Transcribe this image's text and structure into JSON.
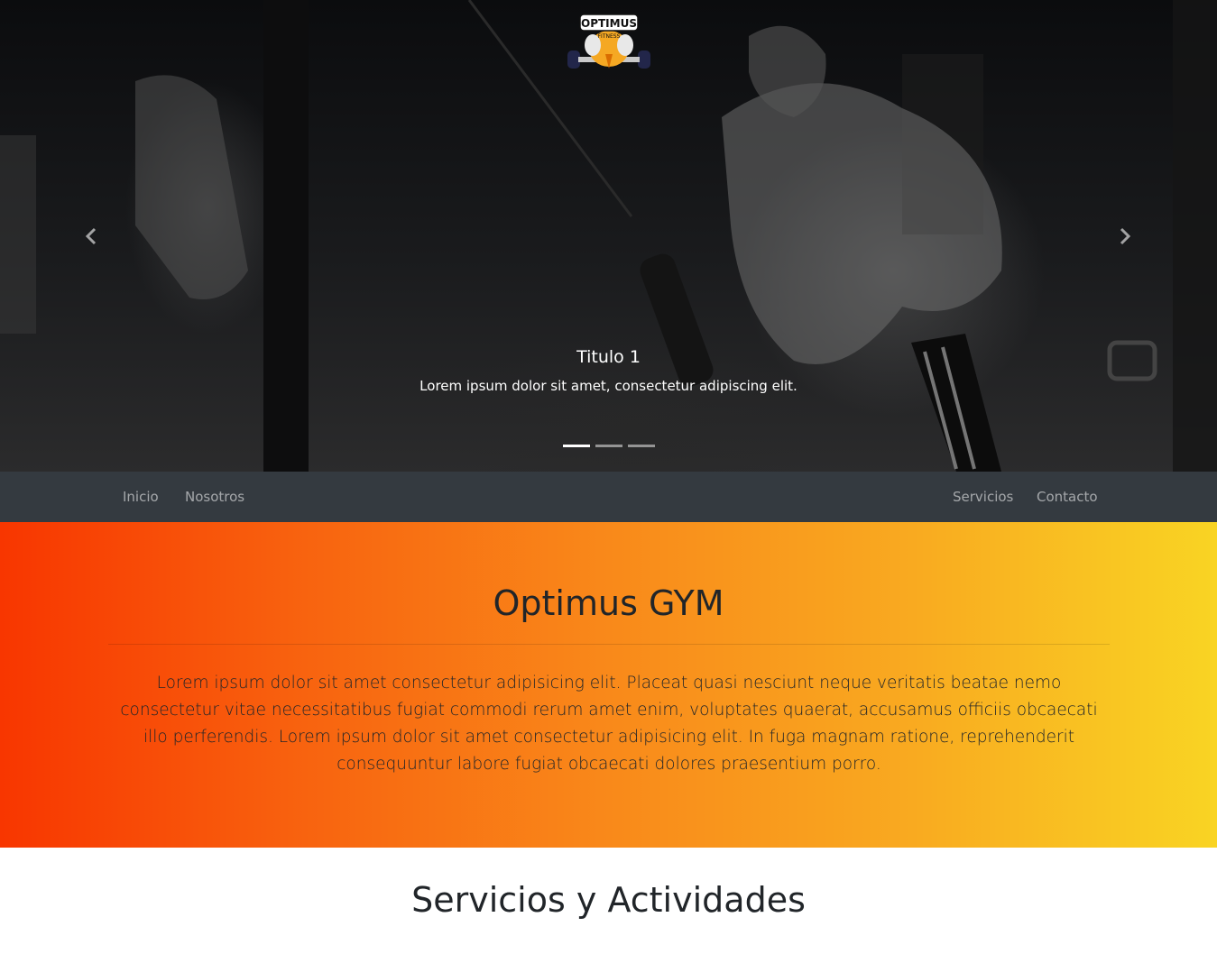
{
  "hero": {
    "logo_text": "OPTIMUS",
    "logo_subtext": "FITNESS",
    "slide_title": "Titulo 1",
    "slide_text": "Lorem ipsum dolor sit amet, consectetur adipiscing elit.",
    "prev_icon": "chevron-left-icon",
    "next_icon": "chevron-right-icon",
    "slide_count": 3,
    "active_slide": 1
  },
  "navbar": {
    "left_links": [
      "Inicio",
      "Nosotros"
    ],
    "right_links": [
      "Servicios",
      "Contacto"
    ]
  },
  "about": {
    "title": "Optimus GYM",
    "text": "Lorem ipsum dolor sit amet consectetur adipisicing elit. Placeat quasi nesciunt neque veritatis beatae nemo consectetur vitae necessitatibus fugiat commodi rerum amet enim, voluptates quaerat, accusamus officiis obcaecati illo perferendis. Lorem ipsum dolor sit amet consectetur adipisicing elit. In fuga magnam ratione, reprehenderit consequuntur labore fugiat obcaecati dolores praesentium porro."
  },
  "services": {
    "title": "Servicios y Actividades"
  },
  "colors": {
    "navbar_bg": "#343a40",
    "gradient_start": "#f83600",
    "gradient_end": "#f9d423"
  }
}
